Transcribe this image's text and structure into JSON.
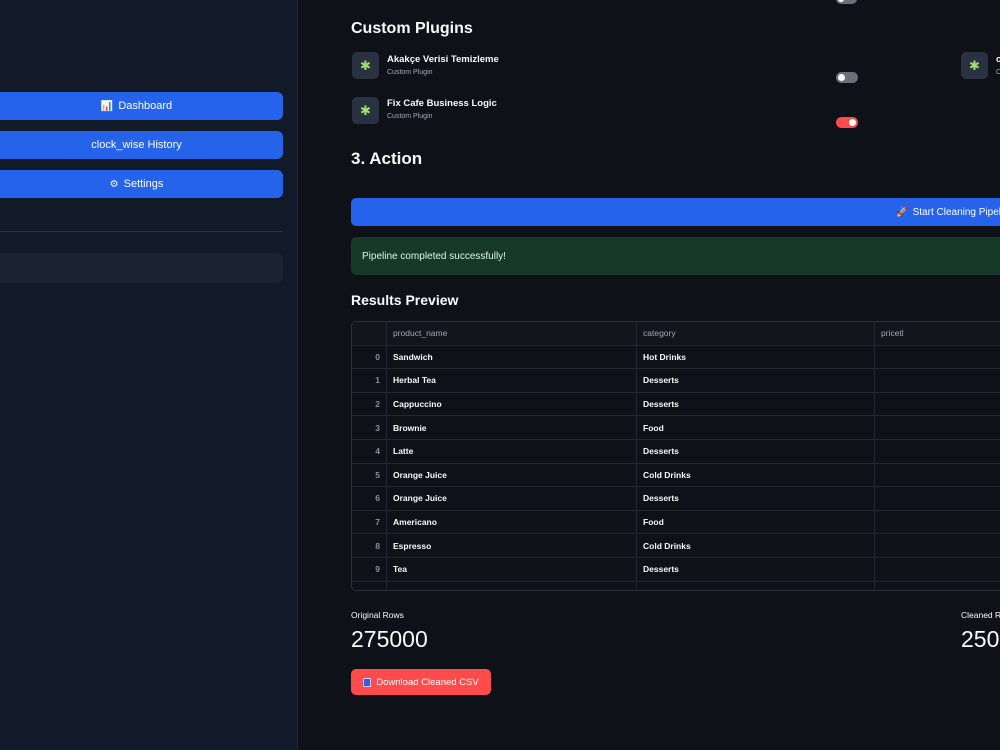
{
  "sidebar": {
    "items": [
      {
        "icon": "bar-chart-icon",
        "glyph": "📊",
        "label": "Dashboard"
      },
      {
        "icon": "",
        "glyph": "",
        "label": "clock_wise History"
      },
      {
        "icon": "gear-icon",
        "glyph": "⚙",
        "label": "Settings"
      }
    ]
  },
  "plugins": {
    "title": "Custom Plugins",
    "items": [
      {
        "name": "Akakçe Verisi Temizleme",
        "sub": "Custom Plugin",
        "enabled": false
      },
      {
        "name": "Fix Cafe Business Logic",
        "sub": "Custom Plugin",
        "enabled": true
      }
    ],
    "partial": {
      "name": "c",
      "sub": "C"
    }
  },
  "action": {
    "title": "3. Action",
    "button_icon": "rocket-icon",
    "button_label": "Start Cleaning Pipel",
    "success_message": "Pipeline completed successfully!"
  },
  "results": {
    "title": "Results Preview",
    "columns": [
      "",
      "product_name",
      "category",
      "pricetl"
    ],
    "rows": [
      [
        "0",
        "Sandwich",
        "Hot Drinks",
        ""
      ],
      [
        "1",
        "Herbal Tea",
        "Desserts",
        ""
      ],
      [
        "2",
        "Cappuccino",
        "Desserts",
        ""
      ],
      [
        "3",
        "Brownie",
        "Food",
        ""
      ],
      [
        "4",
        "Latte",
        "Desserts",
        ""
      ],
      [
        "5",
        "Orange Juice",
        "Cold Drinks",
        ""
      ],
      [
        "6",
        "Orange Juice",
        "Desserts",
        ""
      ],
      [
        "7",
        "Americano",
        "Food",
        ""
      ],
      [
        "8",
        "Espresso",
        "Cold Drinks",
        ""
      ],
      [
        "9",
        "Tea",
        "Desserts",
        ""
      ]
    ]
  },
  "metrics": {
    "original_label": "Original Rows",
    "original_value": "275000",
    "cleaned_label": "Cleaned R",
    "cleaned_value": "250"
  },
  "download": {
    "icon": "file-icon",
    "label": "Download Cleaned CSV"
  },
  "colors": {
    "accent": "#2563eb",
    "danger": "#ff4b4b",
    "success_bg": "#173928"
  }
}
